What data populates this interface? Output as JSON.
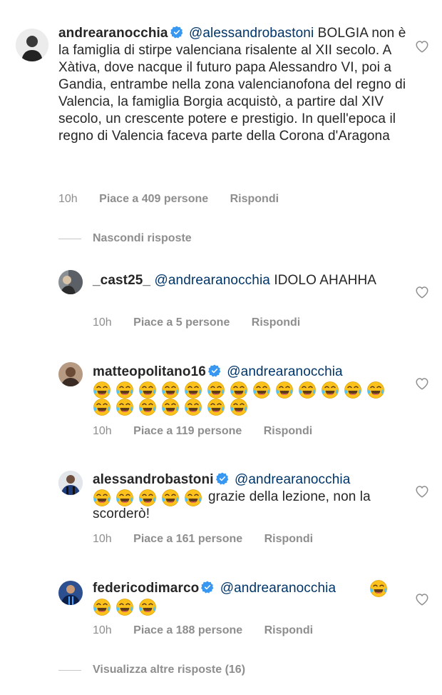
{
  "comment": {
    "username": "andrearanocchia",
    "mention": "@alessandrobastoni",
    "text": "BOLGIA non è la famiglia di stirpe valenciana risalente al XII secolo. A Xàtiva, dove nacque il futuro papa Alessandro VI, poi a Gandia, entrambe nella zona valencianofona del regno di Valencia, la famiglia Borgia acquistò, a partire dal XIV secolo, un crescente potere e prestigio. In quell'epoca il regno di Valencia faceva parte della Corona d'Aragona",
    "time": "10h",
    "likes": "Piace a 409 persone",
    "reply": "Rispondi"
  },
  "hide_replies": "Nascondi risposte",
  "replies": [
    {
      "username": "_cast25_",
      "mention": "@andrearanocchia",
      "text": "IDOLO AHAHHA",
      "time": "10h",
      "likes": "Piace a 5 persone",
      "reply": "Rispondi",
      "verified": false,
      "emoji_count": 0
    },
    {
      "username": "matteopolitano16",
      "mention": "@andrearanocchia",
      "text": "",
      "time": "10h",
      "likes": "Piace a 119 persone",
      "reply": "Rispondi",
      "verified": true,
      "emoji_count": 20
    },
    {
      "username": "alessandrobastoni",
      "mention": "@andrearanocchia",
      "text": "grazie della lezione, non la scorderò!",
      "time": "10h",
      "likes": "Piace a 161 persone",
      "reply": "Rispondi",
      "verified": true,
      "emoji_count": 5
    },
    {
      "username": "federicodimarco",
      "mention": "@andrearanocchia",
      "text": "",
      "time": "10h",
      "likes": "Piace a 188 persone",
      "reply": "Rispondi",
      "verified": true,
      "emoji_count": 4
    }
  ],
  "view_more": "Visualizza altre risposte (16)",
  "icons": {
    "verified": "verified-badge-icon",
    "like": "heart-outline-icon",
    "emoji": "face-with-tears-of-joy-icon"
  },
  "colors": {
    "verified": "#3897f0",
    "mention": "#003569",
    "meta": "#8e8e8e"
  }
}
